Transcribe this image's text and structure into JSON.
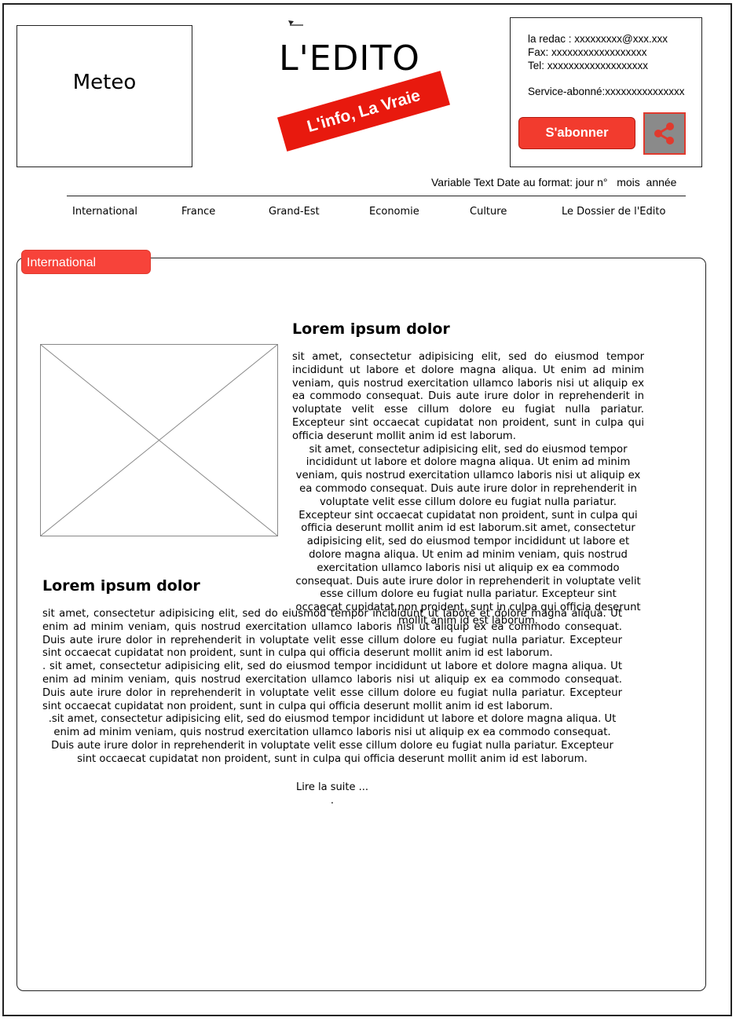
{
  "header": {
    "meteo_label": "Meteo",
    "logo_title": "L'EDITO",
    "tagline": "L'info, La Vraie",
    "contact": {
      "redac": "la redac : xxxxxxxxx@xxx.xxx",
      "fax": "Fax: xxxxxxxxxxxxxxxxxx",
      "tel": "Tel: xxxxxxxxxxxxxxxxxxx",
      "service": "Service-abonné:xxxxxxxxxxxxxxx"
    },
    "subscribe_label": "S'abonner",
    "share_icon": "share-icon",
    "date_text": "Variable Text Date au format: jour n°   mois  année"
  },
  "nav": {
    "items": [
      "International",
      "France",
      "Grand-Est",
      "Economie",
      "Culture",
      "Le Dossier de l'Edito"
    ]
  },
  "section": {
    "tab_label": "International",
    "article1": {
      "title": "Lorem ipsum dolor",
      "para1": "sit amet, consectetur adipisicing elit, sed do eiusmod tempor incididunt ut labore et dolore magna aliqua. Ut enim ad minim veniam, quis nostrud exercitation ullamco laboris nisi ut aliquip ex ea commodo consequat. Duis aute irure dolor in reprehenderit in voluptate velit esse cillum dolore eu fugiat nulla pariatur. Excepteur sint occaecat cupidatat non proident, sunt in culpa qui officia deserunt mollit anim id est laborum.",
      "para2": "sit amet, consectetur adipisicing elit, sed do eiusmod tempor incididunt ut labore et dolore magna aliqua. Ut enim ad minim veniam, quis nostrud exercitation ullamco laboris nisi ut aliquip ex ea commodo consequat. Duis aute irure dolor in reprehenderit in voluptate velit esse cillum dolore eu fugiat nulla pariatur. Excepteur sint occaecat cupidatat non proident, sunt in culpa qui officia deserunt mollit anim id est laborum.sit amet, consectetur adipisicing elit, sed do eiusmod tempor incididunt ut labore et dolore magna aliqua. Ut enim ad minim veniam, quis nostrud exercitation ullamco laboris nisi ut aliquip ex ea commodo consequat. Duis aute irure dolor in reprehenderit in voluptate velit esse cillum dolore eu fugiat nulla pariatur. Excepteur sint occaecat cupidatat non proident, sunt in culpa qui officia deserunt mollit anim id est laborum."
    },
    "article2": {
      "title": "Lorem ipsum dolor",
      "para1": "sit amet, consectetur adipisicing elit, sed do eiusmod tempor incididunt ut labore et dolore magna aliqua. Ut enim ad minim veniam, quis nostrud exercitation ullamco laboris nisi ut aliquip ex ea commodo consequat. Duis aute irure dolor in reprehenderit in voluptate velit esse cillum dolore eu fugiat nulla pariatur. Excepteur sint occaecat cupidatat non proident, sunt in culpa qui officia deserunt mollit anim id est laborum.",
      "para2": ". sit amet, consectetur adipisicing elit, sed do eiusmod tempor incididunt ut labore et dolore magna aliqua. Ut enim ad minim veniam, quis nostrud exercitation ullamco laboris nisi ut aliquip ex ea commodo consequat. Duis aute irure dolor in reprehenderit in voluptate velit esse cillum dolore eu fugiat nulla pariatur. Excepteur sint occaecat cupidatat non proident, sunt in culpa qui officia deserunt mollit anim id est laborum.",
      "para3": ".sit amet, consectetur adipisicing elit, sed do eiusmod tempor incididunt ut labore et dolore magna aliqua. Ut enim ad minim veniam, quis nostrud exercitation ullamco laboris nisi ut aliquip ex ea commodo consequat. Duis aute irure dolor in reprehenderit in voluptate velit esse cillum dolore eu fugiat nulla pariatur. Excepteur sint occaecat cupidatat non proident, sunt in culpa qui officia deserunt mollit anim id est laborum.",
      "read_more": "Lire la suite ...",
      "trailing_dot": "."
    }
  },
  "colors": {
    "accent_red": "#e8190e",
    "tab_red": "#f7433a",
    "share_bg": "#8a8a8a"
  }
}
